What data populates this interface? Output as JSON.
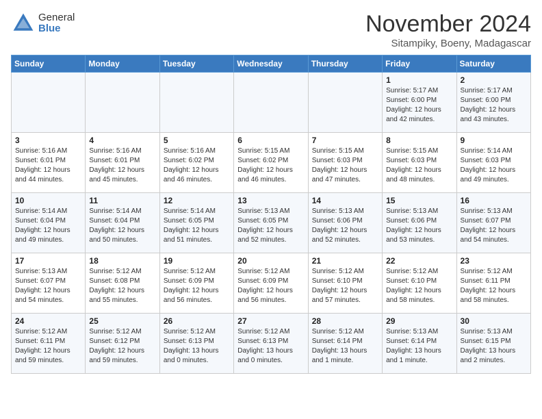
{
  "header": {
    "logo_general": "General",
    "logo_blue": "Blue",
    "title": "November 2024",
    "location": "Sitampiky, Boeny, Madagascar"
  },
  "days_of_week": [
    "Sunday",
    "Monday",
    "Tuesday",
    "Wednesday",
    "Thursday",
    "Friday",
    "Saturday"
  ],
  "weeks": [
    [
      {
        "day": "",
        "info": ""
      },
      {
        "day": "",
        "info": ""
      },
      {
        "day": "",
        "info": ""
      },
      {
        "day": "",
        "info": ""
      },
      {
        "day": "",
        "info": ""
      },
      {
        "day": "1",
        "info": "Sunrise: 5:17 AM\nSunset: 6:00 PM\nDaylight: 12 hours\nand 42 minutes."
      },
      {
        "day": "2",
        "info": "Sunrise: 5:17 AM\nSunset: 6:00 PM\nDaylight: 12 hours\nand 43 minutes."
      }
    ],
    [
      {
        "day": "3",
        "info": "Sunrise: 5:16 AM\nSunset: 6:01 PM\nDaylight: 12 hours\nand 44 minutes."
      },
      {
        "day": "4",
        "info": "Sunrise: 5:16 AM\nSunset: 6:01 PM\nDaylight: 12 hours\nand 45 minutes."
      },
      {
        "day": "5",
        "info": "Sunrise: 5:16 AM\nSunset: 6:02 PM\nDaylight: 12 hours\nand 46 minutes."
      },
      {
        "day": "6",
        "info": "Sunrise: 5:15 AM\nSunset: 6:02 PM\nDaylight: 12 hours\nand 46 minutes."
      },
      {
        "day": "7",
        "info": "Sunrise: 5:15 AM\nSunset: 6:03 PM\nDaylight: 12 hours\nand 47 minutes."
      },
      {
        "day": "8",
        "info": "Sunrise: 5:15 AM\nSunset: 6:03 PM\nDaylight: 12 hours\nand 48 minutes."
      },
      {
        "day": "9",
        "info": "Sunrise: 5:14 AM\nSunset: 6:03 PM\nDaylight: 12 hours\nand 49 minutes."
      }
    ],
    [
      {
        "day": "10",
        "info": "Sunrise: 5:14 AM\nSunset: 6:04 PM\nDaylight: 12 hours\nand 49 minutes."
      },
      {
        "day": "11",
        "info": "Sunrise: 5:14 AM\nSunset: 6:04 PM\nDaylight: 12 hours\nand 50 minutes."
      },
      {
        "day": "12",
        "info": "Sunrise: 5:14 AM\nSunset: 6:05 PM\nDaylight: 12 hours\nand 51 minutes."
      },
      {
        "day": "13",
        "info": "Sunrise: 5:13 AM\nSunset: 6:05 PM\nDaylight: 12 hours\nand 52 minutes."
      },
      {
        "day": "14",
        "info": "Sunrise: 5:13 AM\nSunset: 6:06 PM\nDaylight: 12 hours\nand 52 minutes."
      },
      {
        "day": "15",
        "info": "Sunrise: 5:13 AM\nSunset: 6:06 PM\nDaylight: 12 hours\nand 53 minutes."
      },
      {
        "day": "16",
        "info": "Sunrise: 5:13 AM\nSunset: 6:07 PM\nDaylight: 12 hours\nand 54 minutes."
      }
    ],
    [
      {
        "day": "17",
        "info": "Sunrise: 5:13 AM\nSunset: 6:07 PM\nDaylight: 12 hours\nand 54 minutes."
      },
      {
        "day": "18",
        "info": "Sunrise: 5:12 AM\nSunset: 6:08 PM\nDaylight: 12 hours\nand 55 minutes."
      },
      {
        "day": "19",
        "info": "Sunrise: 5:12 AM\nSunset: 6:09 PM\nDaylight: 12 hours\nand 56 minutes."
      },
      {
        "day": "20",
        "info": "Sunrise: 5:12 AM\nSunset: 6:09 PM\nDaylight: 12 hours\nand 56 minutes."
      },
      {
        "day": "21",
        "info": "Sunrise: 5:12 AM\nSunset: 6:10 PM\nDaylight: 12 hours\nand 57 minutes."
      },
      {
        "day": "22",
        "info": "Sunrise: 5:12 AM\nSunset: 6:10 PM\nDaylight: 12 hours\nand 58 minutes."
      },
      {
        "day": "23",
        "info": "Sunrise: 5:12 AM\nSunset: 6:11 PM\nDaylight: 12 hours\nand 58 minutes."
      }
    ],
    [
      {
        "day": "24",
        "info": "Sunrise: 5:12 AM\nSunset: 6:11 PM\nDaylight: 12 hours\nand 59 minutes."
      },
      {
        "day": "25",
        "info": "Sunrise: 5:12 AM\nSunset: 6:12 PM\nDaylight: 12 hours\nand 59 minutes."
      },
      {
        "day": "26",
        "info": "Sunrise: 5:12 AM\nSunset: 6:13 PM\nDaylight: 13 hours\nand 0 minutes."
      },
      {
        "day": "27",
        "info": "Sunrise: 5:12 AM\nSunset: 6:13 PM\nDaylight: 13 hours\nand 0 minutes."
      },
      {
        "day": "28",
        "info": "Sunrise: 5:12 AM\nSunset: 6:14 PM\nDaylight: 13 hours\nand 1 minute."
      },
      {
        "day": "29",
        "info": "Sunrise: 5:13 AM\nSunset: 6:14 PM\nDaylight: 13 hours\nand 1 minute."
      },
      {
        "day": "30",
        "info": "Sunrise: 5:13 AM\nSunset: 6:15 PM\nDaylight: 13 hours\nand 2 minutes."
      }
    ]
  ]
}
